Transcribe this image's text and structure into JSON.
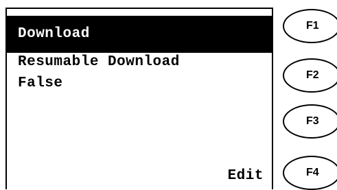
{
  "screen": {
    "title": "Download",
    "lines": [
      "Resumable Download",
      "False"
    ],
    "softkey_f4": "Edit"
  },
  "function_keys": [
    "F1",
    "F2",
    "F3",
    "F4"
  ]
}
